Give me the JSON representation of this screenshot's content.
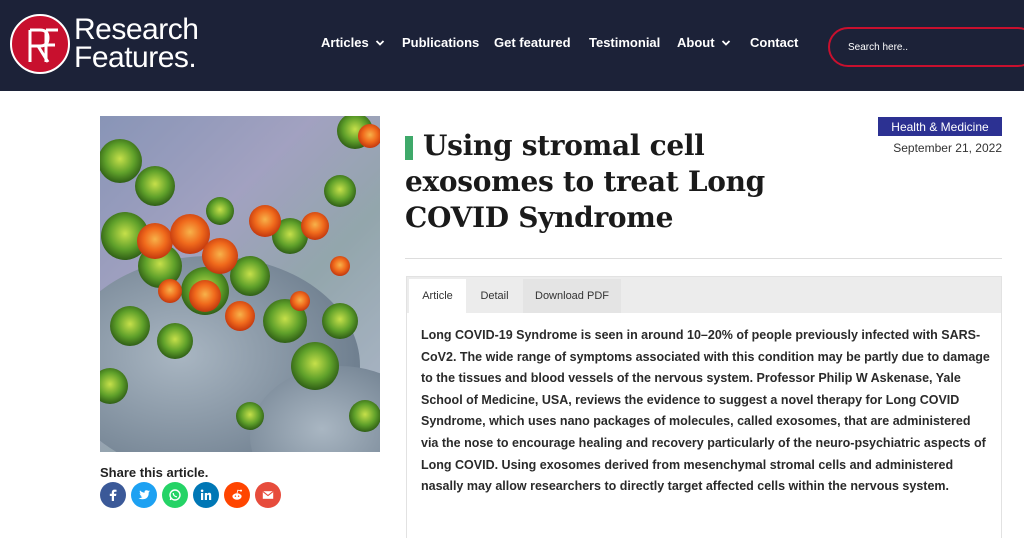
{
  "brand": {
    "line1": "Research",
    "line2": "Features."
  },
  "nav": [
    {
      "label": "Articles",
      "has_dropdown": true
    },
    {
      "label": "Publications",
      "has_dropdown": false
    },
    {
      "label": "Get featured",
      "has_dropdown": false
    },
    {
      "label": "Testimonial",
      "has_dropdown": false
    },
    {
      "label": "About",
      "has_dropdown": true
    },
    {
      "label": "Contact",
      "has_dropdown": false
    }
  ],
  "search": {
    "placeholder": "Search here.."
  },
  "share": {
    "label": "Share this article.",
    "buttons": [
      {
        "icon": "facebook-icon",
        "color": "#3b5998"
      },
      {
        "icon": "twitter-icon",
        "color": "#1da1f2"
      },
      {
        "icon": "whatsapp-icon",
        "color": "#25d366"
      },
      {
        "icon": "linkedin-icon",
        "color": "#0077b5"
      },
      {
        "icon": "reddit-icon",
        "color": "#ff4500"
      },
      {
        "icon": "email-icon",
        "color": "#e74c3c"
      }
    ]
  },
  "article": {
    "category": "Health & Medicine",
    "date": "September 21, 2022",
    "title": "Using stromal cell exosomes to treat Long COVID Syndrome",
    "tabs": [
      "Article",
      "Detail",
      "Download PDF"
    ],
    "active_tab": "Article",
    "body": "Long COVID-19 Syndrome is seen in around 10–20% of people previously infected with SARS-CoV2. The wide range of symptoms associated with this condition may be partly due to damage to the tissues and blood vessels of the nervous system. Professor Philip W Askenase, Yale School of Medicine, USA, reviews the evidence to suggest a novel therapy for Long COVID Syndrome, which uses nano packages of molecules, called exosomes, that are administered via the nose to encourage healing and recovery particularly of the neuro-psychiatric aspects of Long COVID. Using exosomes derived from mesenchymal stromal cells and administered nasally may allow researchers to directly target affected cells within the nervous system."
  },
  "colors": {
    "header_bg": "#1c2238",
    "brand_red": "#c8102e",
    "category_bg": "#2c3192",
    "title_accent": "#3fa96a"
  }
}
